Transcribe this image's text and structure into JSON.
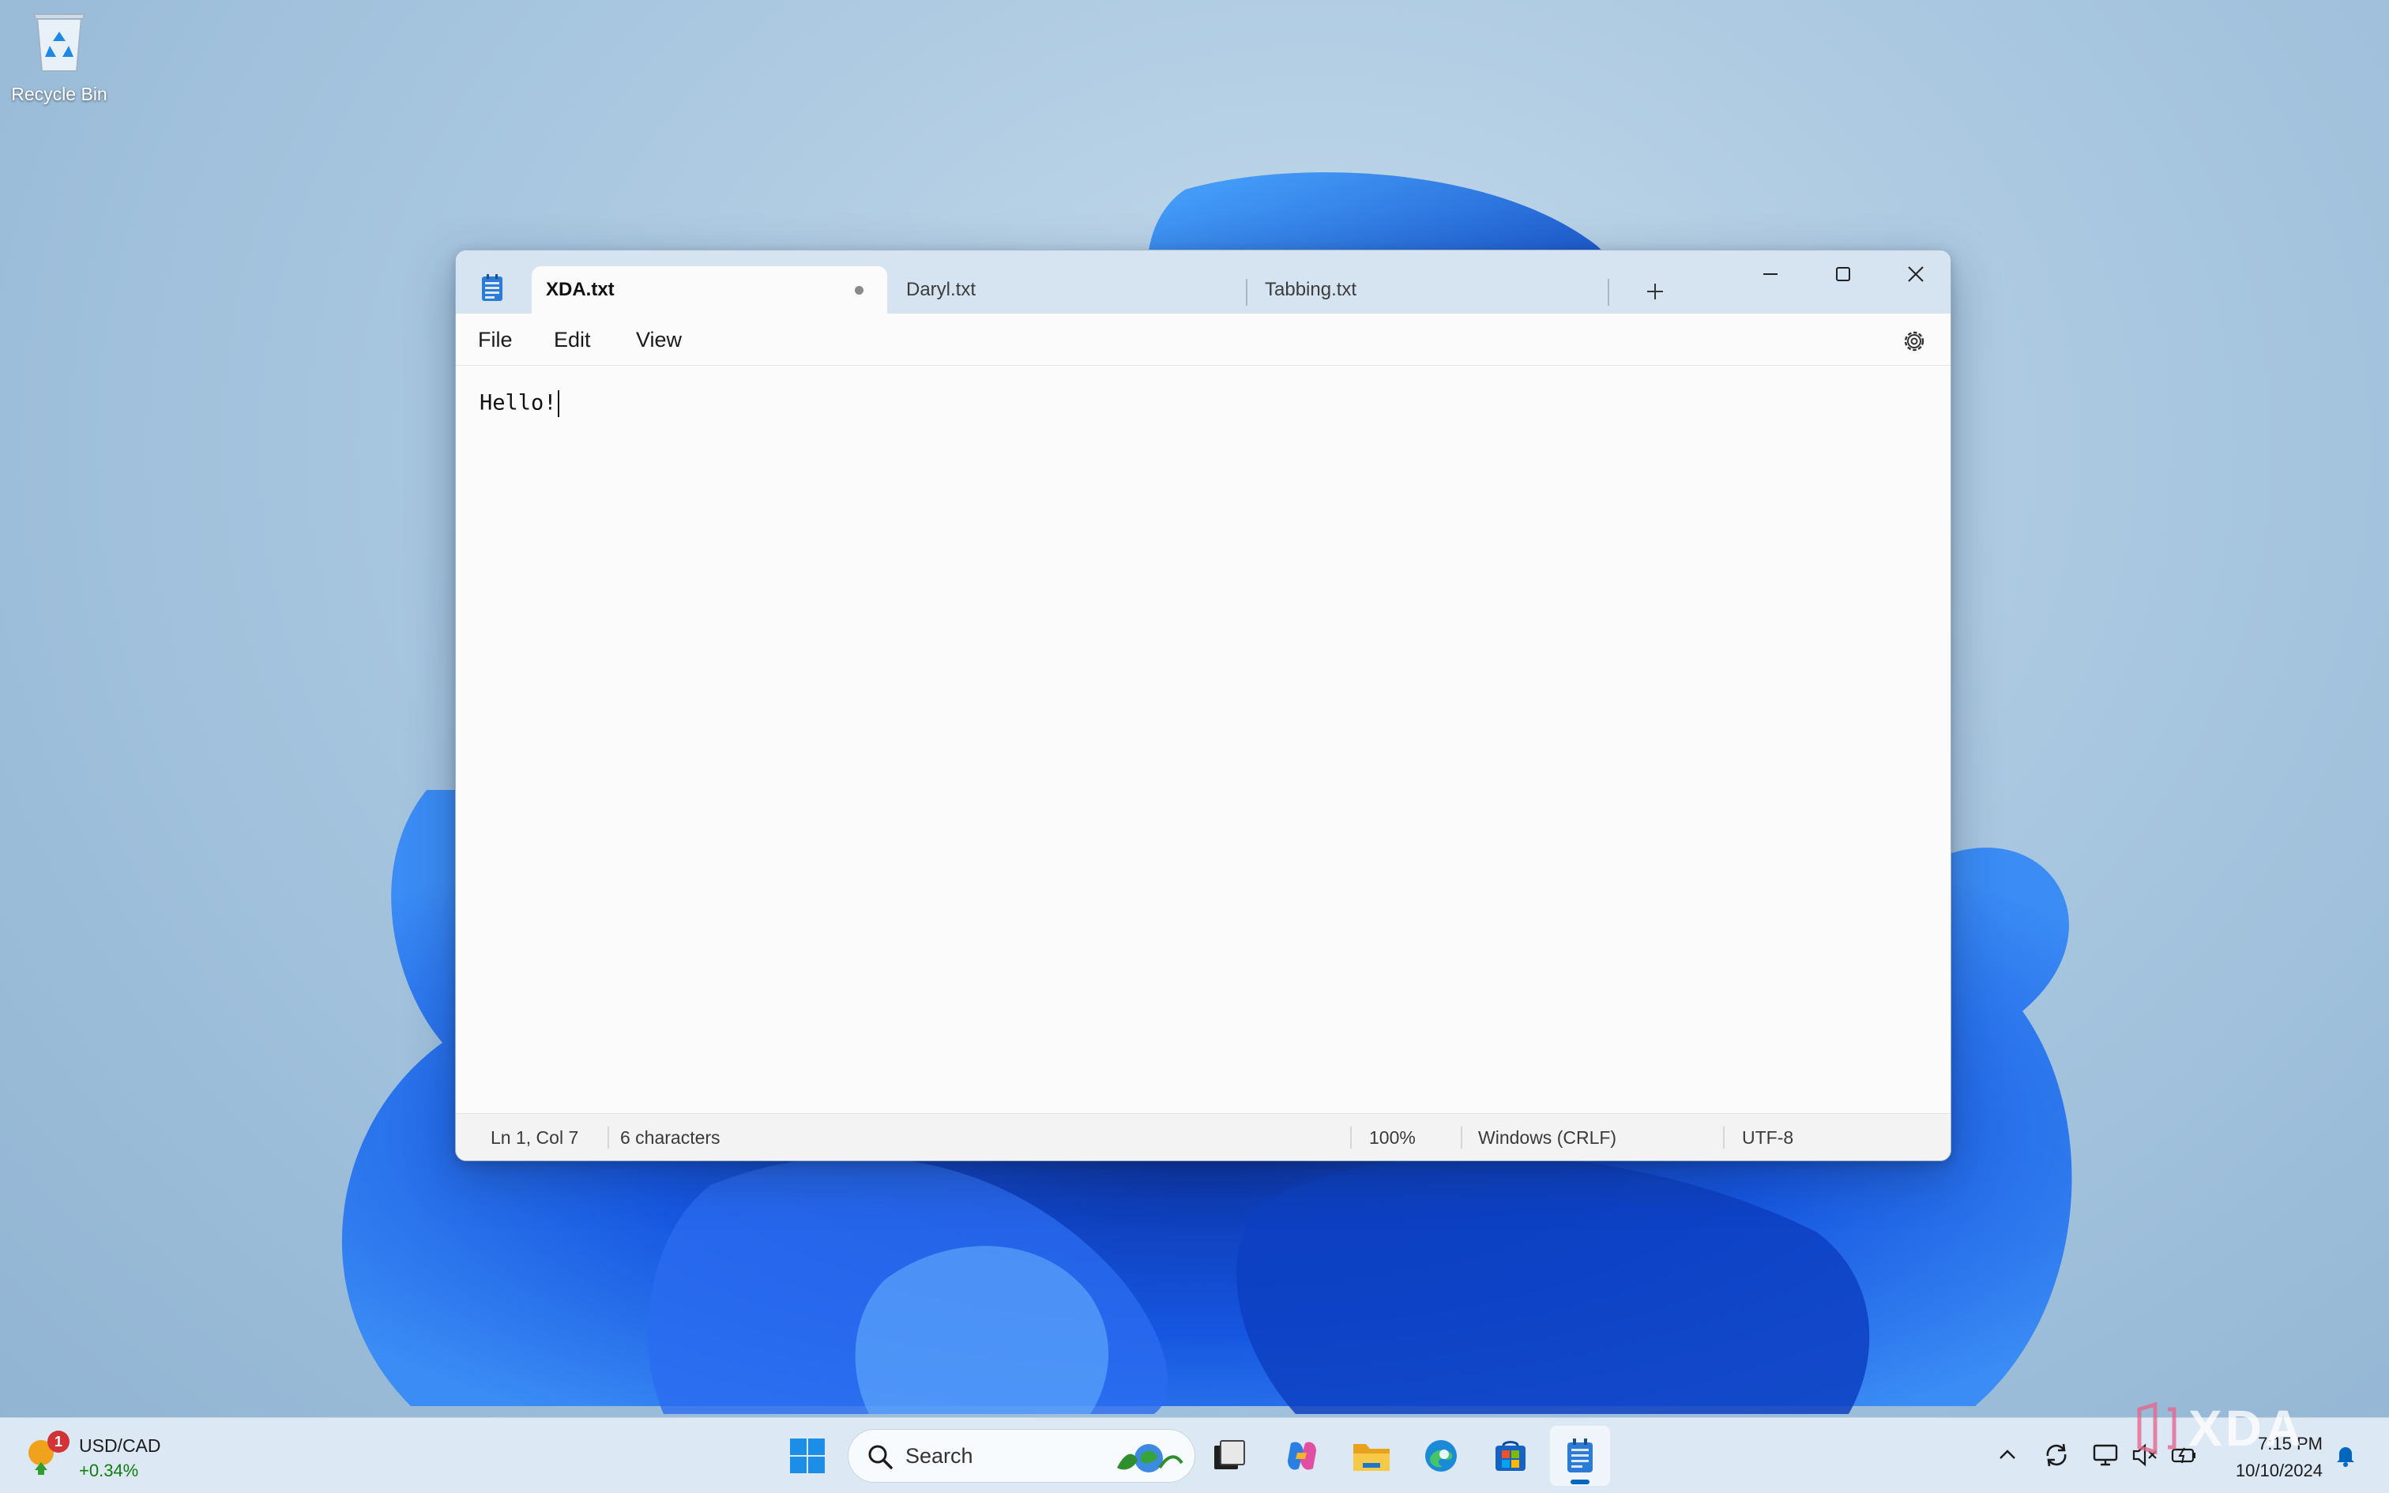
{
  "desktop": {
    "icons": [
      {
        "label": "Recycle Bin",
        "icon": "recycle-bin-icon"
      }
    ]
  },
  "window": {
    "app_icon": "notepad-icon",
    "tabs": [
      {
        "label": "XDA.txt",
        "active": true,
        "unsaved": true
      },
      {
        "label": "Daryl.txt",
        "active": false
      },
      {
        "label": "Tabbing.txt",
        "active": false
      }
    ],
    "new_tab_icon": "plus-icon",
    "controls": [
      "minimize-icon",
      "maximize-icon",
      "close-icon"
    ],
    "menu": {
      "file": "File",
      "edit": "Edit",
      "view": "View"
    },
    "settings_icon": "gear-icon",
    "editor": {
      "content": "Hello!"
    },
    "status": {
      "position": "Ln 1, Col 7",
      "characters": "6 characters",
      "zoom": "100%",
      "line_ending": "Windows (CRLF)",
      "encoding": "UTF-8"
    }
  },
  "taskbar": {
    "widget": {
      "title": "USD/CAD",
      "change": "+0.34%",
      "badge": "1"
    },
    "search": {
      "label": "Search"
    },
    "pinned": [
      "start-icon",
      "task-view-icon",
      "copilot-icon",
      "file-explorer-icon",
      "edge-icon",
      "store-icon",
      "notepad-icon"
    ],
    "tray": [
      "chevron-up-icon",
      "sync-icon",
      "network-icon",
      "volume-mute-icon",
      "battery-icon",
      "notification-bell-icon"
    ],
    "clock": {
      "time": "7:15 PM",
      "date": "10/10/2024"
    }
  },
  "colors": {
    "accent": "#0067c0",
    "titlebar": "#d6e4f1",
    "editor_bg": "#fbfbfb"
  },
  "watermark": "XDA"
}
